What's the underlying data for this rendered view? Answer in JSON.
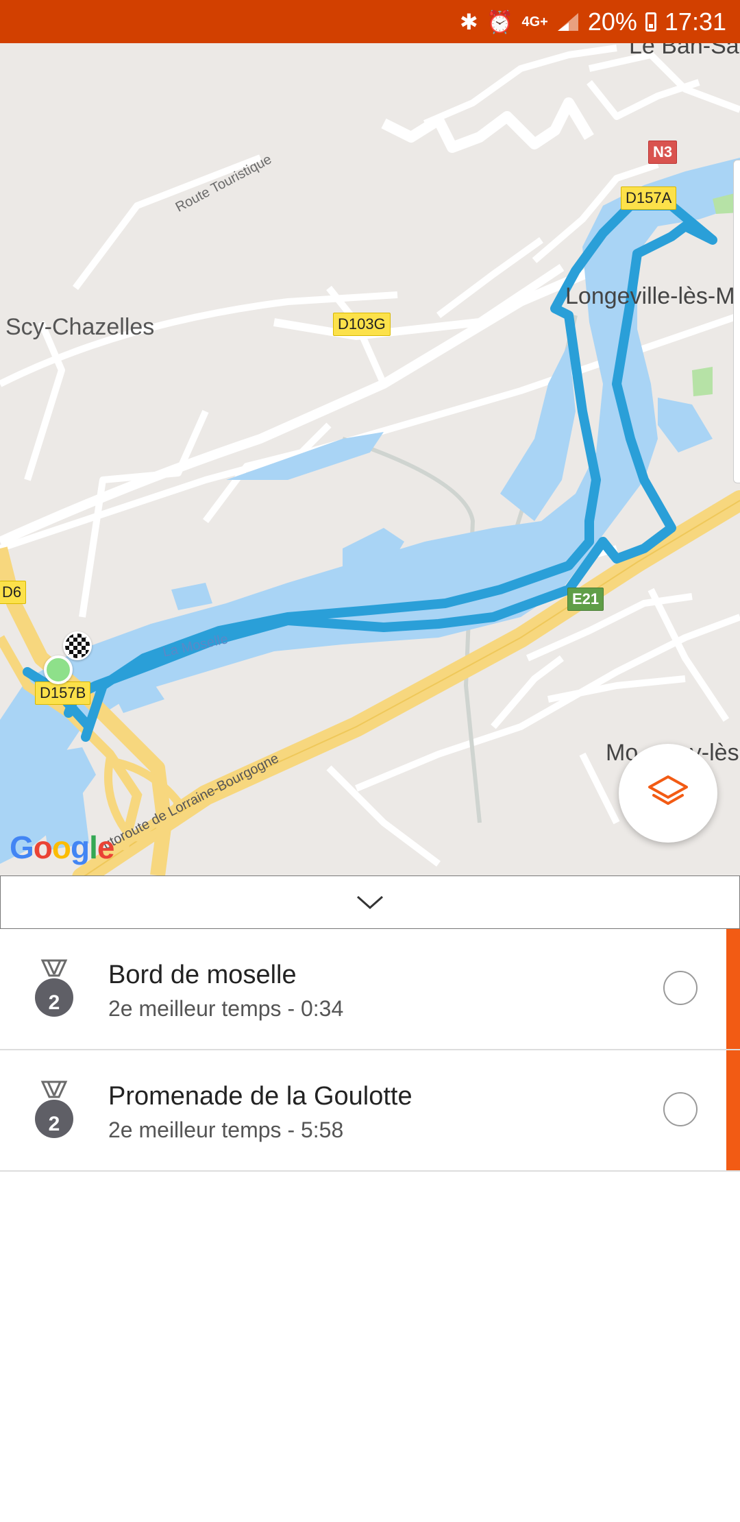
{
  "status_bar": {
    "battery": "20%",
    "time": "17:31",
    "network": "4G+",
    "icons": [
      "bluetooth-icon",
      "alarm-icon",
      "signal-icon",
      "battery-icon"
    ]
  },
  "map": {
    "places": {
      "top_right": "Le Ban-Sai",
      "left": "Scy-Chazelles",
      "right": "Longeville-lès-Me",
      "bottom_right": "Mo        y-lès-"
    },
    "road_shields": {
      "n3": "N3",
      "d157a": "D157A",
      "d103g": "D103G",
      "d6": "D6",
      "d157b": "D157B",
      "e21": "E21"
    },
    "road_names": {
      "route_touristique": "Route Touristique",
      "autoroute": "utoroute de Lorraine-Bourgogne"
    },
    "river": "La Moselle",
    "attribution": [
      "G",
      "o",
      "o",
      "g",
      "l",
      "e"
    ],
    "colors": {
      "route": "#2a9fd8",
      "water": "#a9d4f5",
      "land": "#ece9e6",
      "highway": "#f7d77e",
      "start_marker": "#8ee08a"
    },
    "layers_button_icon": "layers-icon"
  },
  "collapse_icon": "chevron-down-icon",
  "segments": [
    {
      "medal_rank": "2",
      "title": "Bord de moselle",
      "subtitle": "2e meilleur temps - 0:34"
    },
    {
      "medal_rank": "2",
      "title": "Promenade de la Goulotte",
      "subtitle": "2e meilleur temps - 5:58"
    }
  ],
  "accent_color": "#f25b14"
}
